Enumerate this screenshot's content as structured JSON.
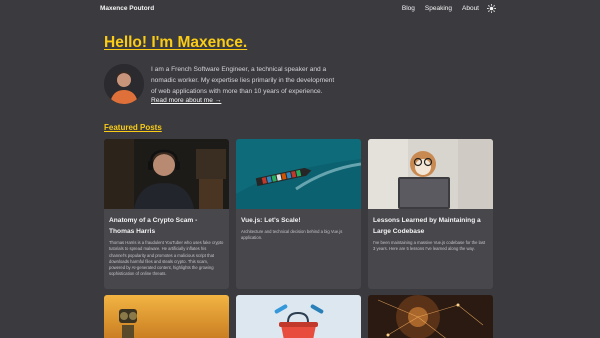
{
  "header": {
    "brand": "Maxence Poutord",
    "nav": [
      "Blog",
      "Speaking",
      "About"
    ],
    "theme_icon": "sun-icon"
  },
  "hero": {
    "title": "Hello! I'm Maxence.",
    "intro": "I am a French Software Engineer, a technical speaker and a nomadic worker. My expertise lies primarily in the development of web applications with more than 10 years of experience.",
    "read_more": "Read more about me →"
  },
  "featured": {
    "heading": "Featured Posts",
    "posts": [
      {
        "title": "Anatomy of a Crypto Scam - Thomas Harris",
        "desc": "Thomas Harris is a fraudulent YouTuber who uses fake crypto tutorials to spread malware. He artificially inflates his channel's popularity and promotes a malicious script that downloads harmful files and steals crypto. This scam, powered by AI-generated content, highlights the growing sophistication of online threats."
      },
      {
        "title": "Vue.js: Let's Scale!",
        "desc": "Architecture and technical decision behind a big Vue.js application."
      },
      {
        "title": "Lessons Learned by Maintaining a Large Codebase",
        "desc": "I've been maintaining a massive Vue.js codebase for the last 3 years. Here are 5 lessons I've learned along the way."
      }
    ]
  },
  "colors": {
    "background": "#3b3b3f",
    "accent": "#facc15",
    "card": "#47474c"
  }
}
